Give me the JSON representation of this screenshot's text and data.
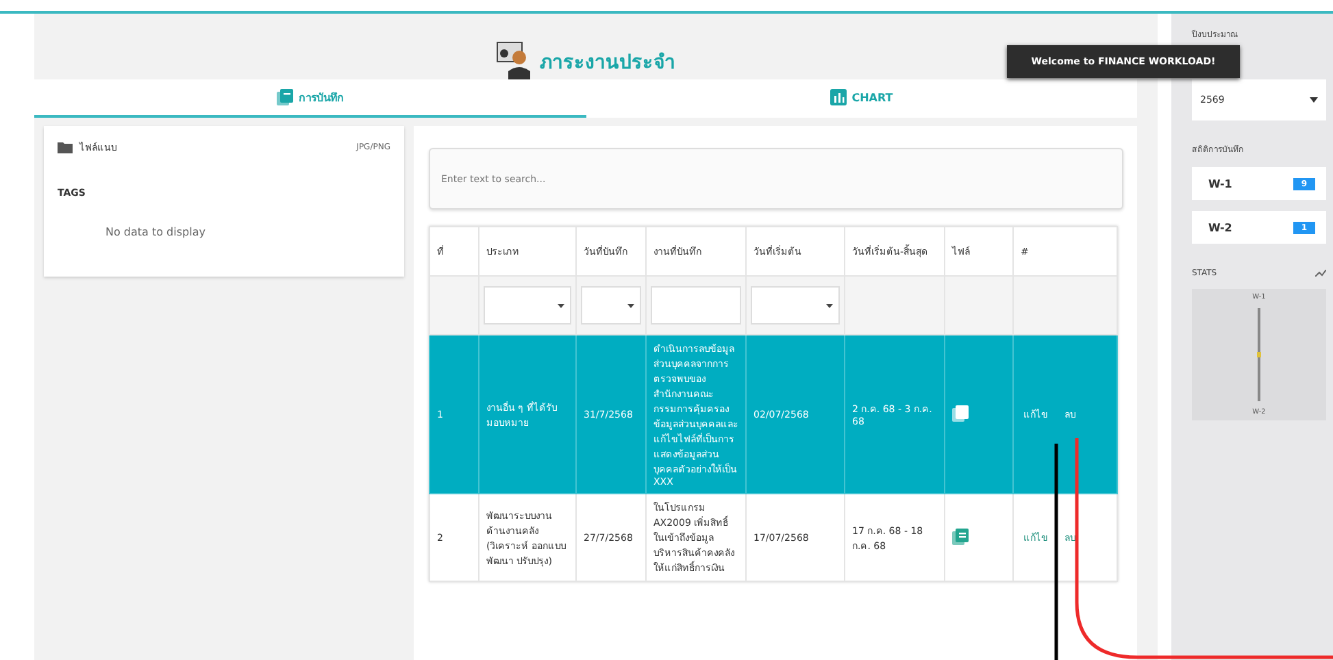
{
  "header": {
    "title": "ภาระงานประจำ"
  },
  "tabs": [
    {
      "label": "การบันทึก",
      "selected": true,
      "kind": "record"
    },
    {
      "label": "CHART",
      "selected": false,
      "kind": "chart"
    }
  ],
  "toast": "Welcome to FINANCE WORKLOAD!",
  "attachments": {
    "label": "ไฟล์แนบ",
    "formats": "JPG/PNG"
  },
  "tags": {
    "title": "TAGS",
    "empty": "No data to display"
  },
  "search": {
    "placeholder": "Enter text to search..."
  },
  "table": {
    "columns": [
      "ที่",
      "ประเภท",
      "วันที่บันทึก",
      "งานที่บันทึก",
      "วันที่เริ่มต้น",
      "วันที่เริ่มต้น-สิ้นสุด",
      "ไฟล์",
      "#"
    ],
    "filters": [
      {
        "kind": "none"
      },
      {
        "kind": "select"
      },
      {
        "kind": "select"
      },
      {
        "kind": "input"
      },
      {
        "kind": "select"
      },
      {
        "kind": "none"
      },
      {
        "kind": "none"
      },
      {
        "kind": "none"
      }
    ],
    "rows": [
      {
        "selected": true,
        "cells": [
          "1",
          "งานอื่น ๆ ที่ได้รับมอบหมาย",
          "31/7/2568",
          "ดำเนินการลบข้อมูลส่วนบุคคลจากการตรวจพบของสำนักงานคณะกรรมการคุ้มครองข้อมูลส่วนบุคคลและแก้ไขไฟล์ที่เป็นการแสดงข้อมูลส่วนบุคคลตัวอย่างให้เป็น XXX",
          "02/07/2568",
          "2 ก.ค. 68 - 3 ก.ค. 68"
        ],
        "actions": [
          "แก้ไข",
          "ลบ"
        ]
      },
      {
        "selected": false,
        "cells": [
          "2",
          "พัฒนาระบบงานด้านงานคลัง (วิเคราะห์ ออกแบบ พัฒนา ปรับปรุง)",
          "27/7/2568",
          "ในโปรแกรม AX2009 เพิ่มสิทธิ์ในเข้าถึงข้อมูลบริหารสินค้าคงคลังให้แก่สิทธิ์การเงิน",
          "17/07/2568",
          "17 ก.ค. 68 - 18 ก.ค. 68"
        ],
        "actions": [
          "แก้ไข",
          "ลบ"
        ]
      }
    ]
  },
  "sidebar": {
    "year_label": "ปีงบประมาณ",
    "year": "2569",
    "stats_label": "สถิติการบันทึก",
    "counts": [
      {
        "label": "W-1",
        "count": "9"
      },
      {
        "label": "W-2",
        "count": "1"
      }
    ],
    "stats_title": "STATS",
    "chart_labels": [
      "W-1",
      "W-2"
    ]
  }
}
